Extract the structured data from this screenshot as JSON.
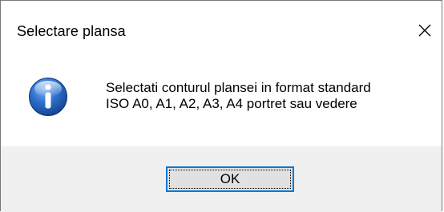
{
  "dialog": {
    "title": "Selectare plansa",
    "close_icon": "close-icon",
    "icon": "information-icon",
    "message_lines": [
      "Selectati conturul plansei in format standard",
      "ISO A0, A1, A2, A3, A4 portret sau vedere"
    ],
    "ok_label": "OK"
  },
  "colors": {
    "accent_border": "#0078d7",
    "button_face": "#e1e1e1",
    "footer_bg": "#f0f0f0",
    "info_icon_blue": "#1a5fb4"
  }
}
